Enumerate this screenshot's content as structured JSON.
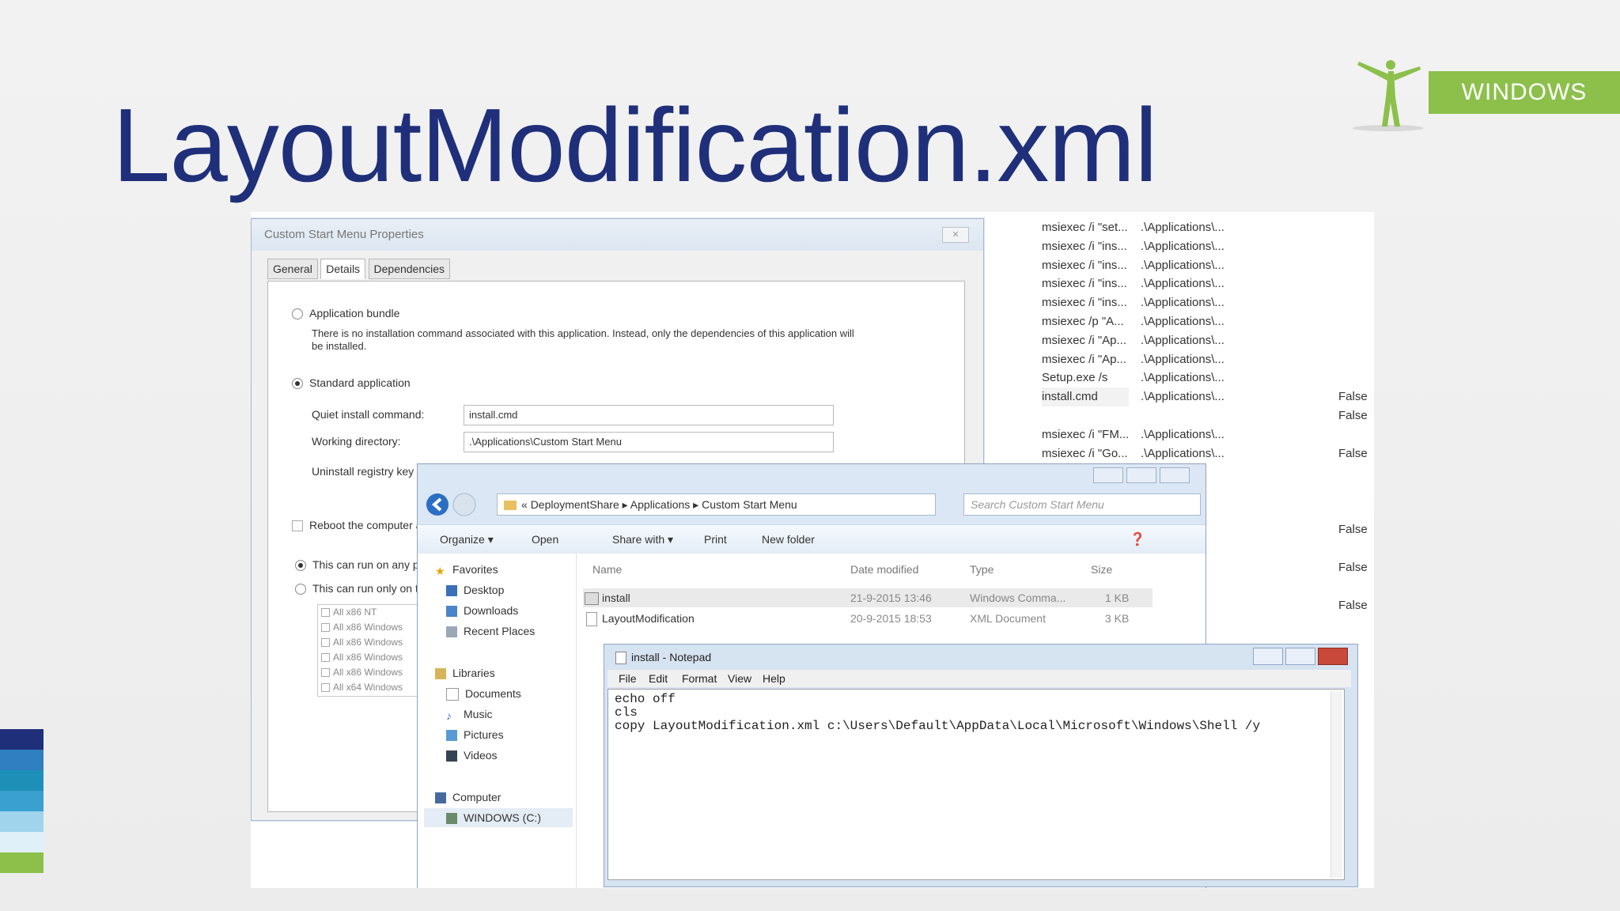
{
  "slide": {
    "title": "LayoutModification.xml",
    "badge": "WINDOWS",
    "stripe_colors": [
      "#1f2f7a",
      "#2f7fc1",
      "#1e90b8",
      "#3aa0d0",
      "#9fd4ec",
      "#dff0f8",
      "#8cc04b"
    ]
  },
  "background_list": {
    "commands": [
      "msiexec /i \"set...",
      "msiexec /i \"ins...",
      "msiexec /i \"ins...",
      "msiexec /i \"ins...",
      "msiexec /i \"ins...",
      "msiexec /p \"A...",
      "msiexec /i \"Ap...",
      "msiexec /i \"Ap...",
      "Setup.exe /s",
      "install.cmd",
      "",
      "msiexec /i \"FM...",
      "msiexec /i \"Go..."
    ],
    "paths": [
      ".\\Applications\\...",
      ".\\Applications\\...",
      ".\\Applications\\...",
      ".\\Applications\\...",
      ".\\Applications\\...",
      ".\\Applications\\...",
      ".\\Applications\\...",
      ".\\Applications\\...",
      ".\\Applications\\...",
      ".\\Applications\\...",
      "",
      ".\\Applications\\...",
      ".\\Applications\\..."
    ],
    "false_values": [
      "False",
      "False",
      "False",
      "False",
      "False",
      "False"
    ]
  },
  "properties_window": {
    "title": "Custom Start Menu Properties",
    "tabs": [
      "General",
      "Details",
      "Dependencies"
    ],
    "application_bundle_label": "Application bundle",
    "bundle_note_line1": "There is no installation command associated with this application.  Instead, only the dependencies of this application will",
    "bundle_note_line2": "be installed.",
    "standard_application_label": "Standard application",
    "quiet_install_label": "Quiet install command:",
    "quiet_install_value": "install.cmd",
    "working_dir_label": "Working directory:",
    "working_dir_value": ".\\Applications\\Custom Start Menu",
    "uninstall_key_label": "Uninstall registry key n",
    "reboot_label": "Reboot the computer a",
    "run_any_label": "This can run on any p",
    "run_only_label": "This can run only on tl",
    "os_list": [
      "All x86 NT",
      "All x86 Windows",
      "All x86 Windows",
      "All x86 Windows",
      "All x86 Windows",
      "All x64 Windows"
    ]
  },
  "explorer_window": {
    "breadcrumb": [
      "DeploymentShare",
      "Applications",
      "Custom Start Menu"
    ],
    "search_placeholder": "Search Custom Start Menu",
    "toolbar": {
      "organize": "Organize ▾",
      "open": "Open",
      "share_with": "Share with ▾",
      "print": "Print",
      "new_folder": "New folder"
    },
    "nav": {
      "favorites": "Favorites",
      "desktop": "Desktop",
      "downloads": "Downloads",
      "recent": "Recent Places",
      "libraries": "Libraries",
      "documents": "Documents",
      "music": "Music",
      "pictures": "Pictures",
      "videos": "Videos",
      "computer": "Computer",
      "drive": "WINDOWS (C:)"
    },
    "columns": {
      "name": "Name",
      "date": "Date modified",
      "type": "Type",
      "size": "Size"
    },
    "files": [
      {
        "name": "install",
        "date": "21-9-2015 13:46",
        "type": "Windows Comma...",
        "size": "1 KB"
      },
      {
        "name": "LayoutModification",
        "date": "20-9-2015 18:53",
        "type": "XML Document",
        "size": "3 KB"
      }
    ]
  },
  "notepad_window": {
    "title": "install - Notepad",
    "menu": [
      "File",
      "Edit",
      "Format",
      "View",
      "Help"
    ],
    "lines": [
      "echo off",
      "cls",
      "copy LayoutModification.xml c:\\Users\\Default\\AppData\\Local\\Microsoft\\Windows\\Shell /y"
    ]
  }
}
